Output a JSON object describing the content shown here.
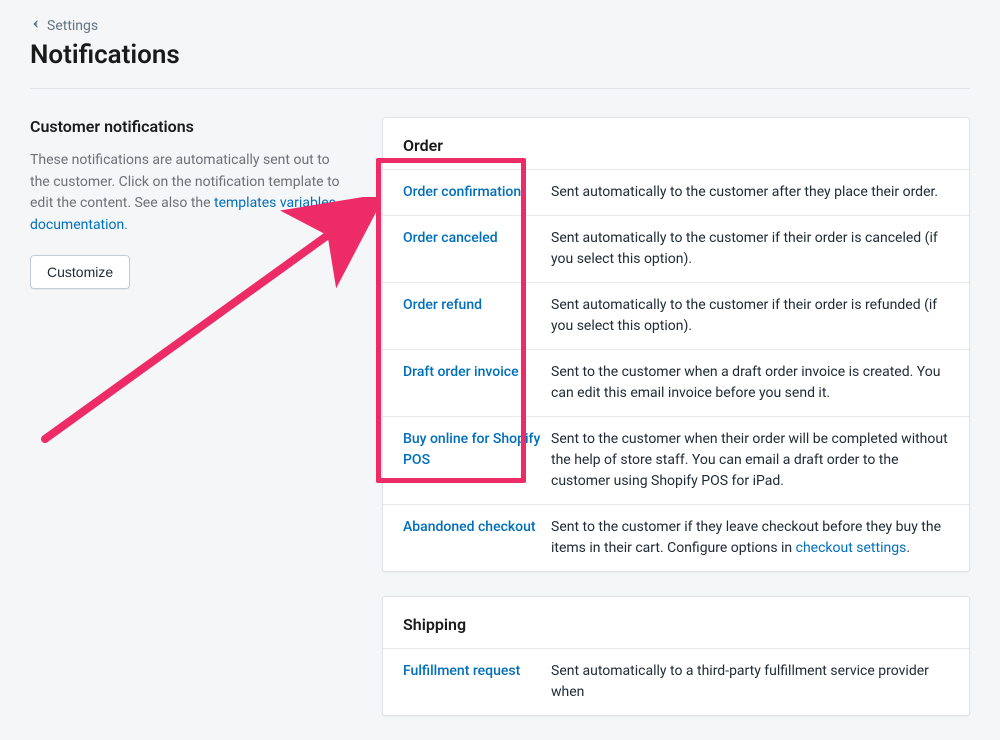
{
  "breadcrumb": {
    "label": "Settings"
  },
  "page_title": "Notifications",
  "sidebar": {
    "heading": "Customer notifications",
    "desc_prefix": "These notifications are automatically sent out to the customer. Click on the notification template to edit the content. See also the ",
    "desc_link": "templates variables documentation",
    "desc_suffix": ".",
    "customize_btn": "Customize"
  },
  "sections": [
    {
      "title": "Order",
      "items": [
        {
          "name": "Order confirmation",
          "desc": "Sent automatically to the customer after they place their order."
        },
        {
          "name": "Order canceled",
          "desc": "Sent automatically to the customer if their order is canceled (if you select this option)."
        },
        {
          "name": "Order refund",
          "desc": "Sent automatically to the customer if their order is refunded (if you select this option)."
        },
        {
          "name": "Draft order invoice",
          "desc": "Sent to the customer when a draft order invoice is created. You can edit this email invoice before you send it."
        },
        {
          "name": "Buy online for Shopify POS",
          "desc": "Sent to the customer when their order will be completed without the help of store staff. You can email a draft order to the customer using Shopify POS for iPad."
        },
        {
          "name": "Abandoned checkout",
          "desc_prefix": "Sent to the customer if they leave checkout before they buy the items in their cart. Configure options in ",
          "link": "checkout settings",
          "desc_suffix": "."
        }
      ]
    },
    {
      "title": "Shipping",
      "items": [
        {
          "name": "Fulfillment request",
          "desc": "Sent automatically to a third-party fulfillment service provider when"
        }
      ]
    }
  ]
}
